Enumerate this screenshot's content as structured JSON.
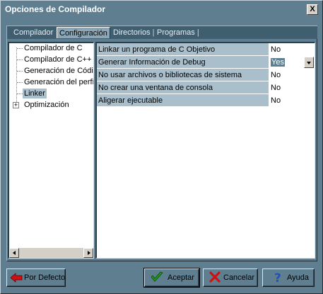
{
  "window": {
    "title": "Opciones de Compilador",
    "close_label": "X"
  },
  "tabs": [
    {
      "label": "Compilador"
    },
    {
      "label": "Configuración",
      "active": true
    },
    {
      "label": "Directorios"
    },
    {
      "label": "Programas"
    }
  ],
  "tab_separator": "|",
  "tree": {
    "items": [
      {
        "label": "Compilador de C"
      },
      {
        "label": "Compilador de C++"
      },
      {
        "label": "Generación de Códi"
      },
      {
        "label": "Generación del perfi"
      },
      {
        "label": "Linker",
        "selected": true
      },
      {
        "label": "Optimización",
        "expandable": true
      }
    ],
    "expander_glyph": "+"
  },
  "grid": {
    "rows": [
      {
        "label": "Linkar un programa de C Objetivo",
        "value": "No"
      },
      {
        "label": "Generar Información de Debug",
        "value": "Yes",
        "editing": true
      },
      {
        "label": "No usar archivos o bibliotecas de sistema",
        "value": "No"
      },
      {
        "label": "No crear una ventana de consola",
        "value": "No"
      },
      {
        "label": "Aligerar ejecutable",
        "value": "No"
      }
    ]
  },
  "buttons": {
    "defaults": {
      "label": "Por Defecto",
      "icon": "red-left-arrow-icon"
    },
    "accept": {
      "label": "Aceptar",
      "icon": "green-check-icon"
    },
    "cancel": {
      "label": "Cancelar",
      "icon": "red-x-icon"
    },
    "help": {
      "label": "Ayuda",
      "icon": "question-mark-icon"
    }
  },
  "colors": {
    "dialog_bg": "#5f7f91",
    "selection_bg": "#a9bfcc",
    "accept_icon": "#1f9a1f",
    "cancel_icon": "#d01010",
    "help_icon": "#1f4fc0"
  }
}
